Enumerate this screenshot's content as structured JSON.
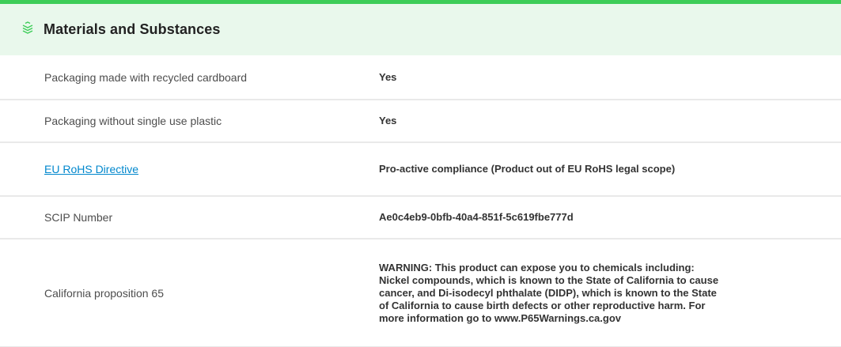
{
  "section": {
    "title": "Materials and Substances",
    "icon": "layers-icon",
    "accent_color": "#3dcd58",
    "header_bg": "#e9f8ec",
    "link_color": "#0087cd"
  },
  "rows": [
    {
      "label": "Packaging made with recycled cardboard",
      "value": "Yes"
    },
    {
      "label": "Packaging without single use plastic",
      "value": "Yes"
    },
    {
      "label": "EU RoHS Directive",
      "value": "Pro-active compliance (Product out of EU RoHS legal scope)"
    },
    {
      "label": "SCIP Number",
      "value": "Ae0c4eb9-0bfb-40a4-851f-5c619fbe777d"
    },
    {
      "label": "California proposition 65",
      "value": "WARNING: This product can expose you to chemicals including: Nickel compounds, which is known to the State of California to cause cancer, and Di-isodecyl phthalate (DIDP), which is known to the State of California to cause birth defects or other reproductive harm. For more information go to www.P65Warnings.ca.gov"
    }
  ]
}
